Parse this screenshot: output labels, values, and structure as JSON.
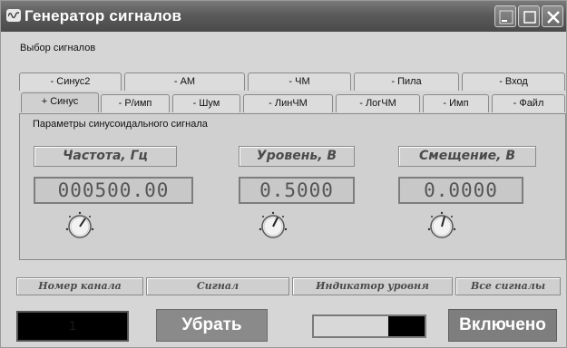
{
  "window": {
    "title": "Генератор сигналов"
  },
  "signal_select": {
    "label": "Выбор сигналов",
    "tabs_row1": [
      "- Синус2",
      "- АМ",
      "- ЧМ",
      "- Пила",
      "- Вход"
    ],
    "tabs_row2": [
      "+ Синус",
      "- Р/имп",
      "- Шум",
      "- ЛинЧМ",
      "- ЛогЧМ",
      "- Имп",
      "- Файл"
    ],
    "active_tab": "+ Синус"
  },
  "panel": {
    "caption": "Параметры синусоидального сигнала",
    "params": [
      {
        "label": "Частота, Гц",
        "value": "000500.00"
      },
      {
        "label": "Уровень, В",
        "value": "0.5000"
      },
      {
        "label": "Смещение, В",
        "value": "0.0000"
      }
    ]
  },
  "bottom": {
    "labels": [
      "Номер канала",
      "Сигнал",
      "Индикатор уровня",
      "Все сигналы"
    ],
    "channel_number": "1",
    "remove_label": "Убрать",
    "level_fraction": 0.33,
    "on_label": "Включено"
  },
  "icons": {
    "title": "app-icon",
    "minimize": "minimize-icon",
    "maximize": "maximize-icon",
    "close": "close-icon",
    "knob": "knob-icon"
  },
  "colors": {
    "titlebar": "#5a5a5a",
    "window_bg": "#d6d6d6",
    "display_bg": "#000000",
    "button_bg": "#8a8a8a"
  }
}
